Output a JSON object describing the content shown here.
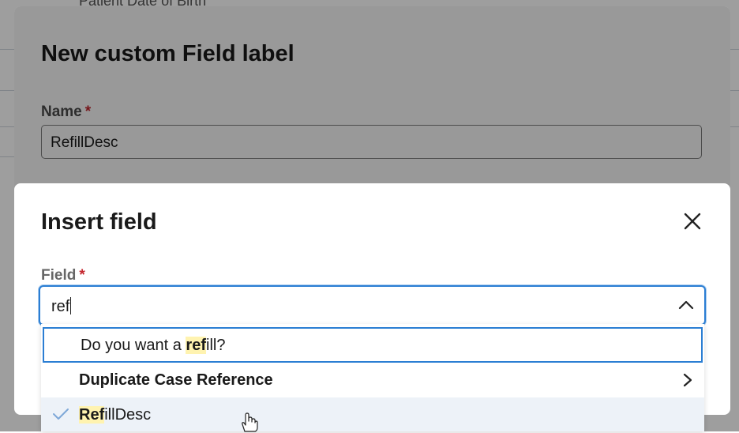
{
  "background": {
    "partial_label": "Patient Date of Birth"
  },
  "outer_modal": {
    "title": "New custom Field label",
    "name_label": "Name",
    "required_mark": "*",
    "name_value": "RefillDesc"
  },
  "insert_modal": {
    "title": "Insert field",
    "close_icon": "close-icon",
    "field_label": "Field",
    "required_mark": "*",
    "field_value": "ref",
    "toggle_icon": "chevron-up-icon"
  },
  "dropdown": {
    "options": [
      {
        "prefix": "Do you want a ",
        "match": "ref",
        "suffix": "ill?",
        "state": "focused"
      },
      {
        "label": "Duplicate Case Reference",
        "icon": "chevron-right-icon",
        "state": "normal"
      },
      {
        "match": "Ref",
        "suffix": "illDesc",
        "icon": "check-icon",
        "state": "selected"
      }
    ]
  },
  "colors": {
    "accent": "#2b7ed3",
    "required": "#c4262e",
    "highlight": "#fff3b0",
    "selected_row": "#edf2f8"
  }
}
